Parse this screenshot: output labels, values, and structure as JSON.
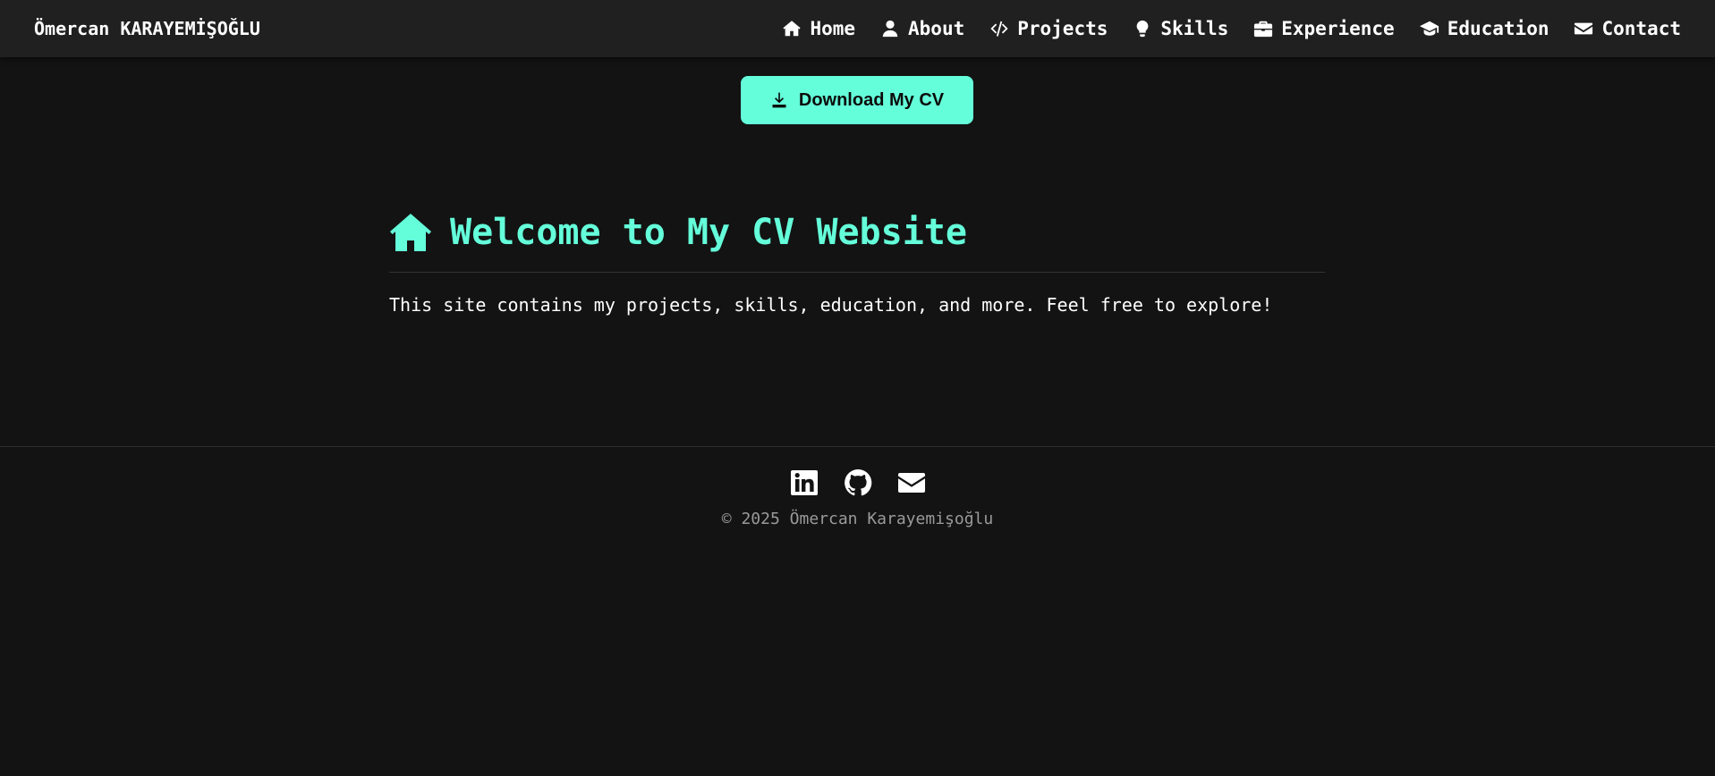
{
  "brand": "Ömercan KARAYEMİŞOĞLU",
  "nav": [
    {
      "label": "Home",
      "icon": "home-icon"
    },
    {
      "label": "About",
      "icon": "user-icon"
    },
    {
      "label": "Projects",
      "icon": "code-icon"
    },
    {
      "label": "Skills",
      "icon": "lightbulb-icon"
    },
    {
      "label": "Experience",
      "icon": "briefcase-icon"
    },
    {
      "label": "Education",
      "icon": "graduation-cap-icon"
    },
    {
      "label": "Contact",
      "icon": "envelope-icon"
    }
  ],
  "cv_button": {
    "label": "Download My CV",
    "icon": "download-icon"
  },
  "hero": {
    "title": "Welcome to My CV Website",
    "icon": "home-icon",
    "text": "This site contains my projects, skills, education, and more. Feel free to explore!"
  },
  "footer": {
    "socials": [
      "linkedin-icon",
      "github-icon",
      "envelope-icon"
    ],
    "copyright": "© 2025 Ömercan Karayemişoğlu"
  },
  "colors": {
    "accent": "#64ffda",
    "background": "#131313",
    "navbar": "#202020"
  }
}
